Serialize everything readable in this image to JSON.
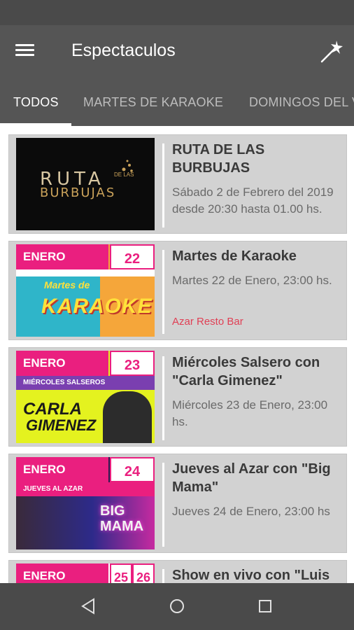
{
  "app_bar": {
    "title": "Espectaculos"
  },
  "tabs": [
    "TODOS",
    "MARTES DE KARAOKE",
    "DOMINGOS DEL V"
  ],
  "events": [
    {
      "title": "RUTA DE LAS BURBUJAS",
      "date": "Sábado 2 de Febrero del 2019 desde 20:30 hasta 01.00 hs.",
      "venue": "",
      "poster": {
        "line1": "RUTA",
        "small": "DE LAS",
        "line2": "BURBUJAS"
      }
    },
    {
      "title": "Martes de Karaoke",
      "date": "Martes 22 de Enero, 23:00 hs.",
      "venue": "Azar Resto Bar",
      "poster": {
        "month": "ENERO",
        "day": "22",
        "script": "Martes de",
        "big": "KARAOKE"
      }
    },
    {
      "title": "Miércoles Salsero con \"Carla Gimenez\"",
      "date": "Miércoles 23 de Enero, 23:00 hs.",
      "venue": "",
      "poster": {
        "month": "ENERO",
        "day": "23",
        "band": "MIÉRCOLES SALSEROS",
        "line1": "CARLA",
        "line2": "GIMENEZ"
      }
    },
    {
      "title": "Jueves al Azar con \"Big Mama\"",
      "date": "Jueves 24 de Enero, 23:00 hs",
      "venue": "",
      "poster": {
        "month": "ENERO",
        "day": "24",
        "band": "JUEVES AL AZAR",
        "line1": "BIG",
        "line2": "MAMA"
      }
    },
    {
      "title": "Show en vivo con \"Luis",
      "date": "",
      "venue": "",
      "poster": {
        "month": "ENERO",
        "day": "25",
        "day2": "26"
      }
    }
  ],
  "colors": {
    "accent_pink": "#ea1f7f",
    "venue_red": "#e04055",
    "bar_gray": "#555555"
  },
  "icons": [
    "menu-icon",
    "magic-wand-icon",
    "back-icon",
    "home-icon",
    "recents-icon"
  ]
}
